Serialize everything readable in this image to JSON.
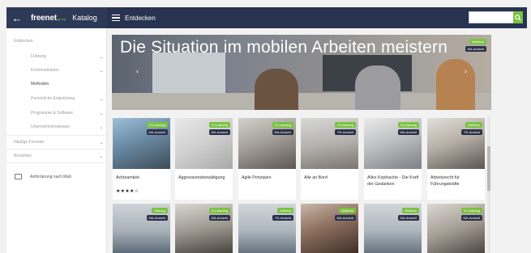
{
  "header": {
    "back_icon": "arrow-left-icon",
    "brand": "freenet",
    "brand_sub": "group",
    "catalog_label": "Katalog",
    "menu_icon": "hamburger-icon",
    "nav_title": "Entdecken",
    "search_placeholder": "",
    "search_icon": "search-icon",
    "accent_color": "#7cc242",
    "bar_color": "#273350"
  },
  "sidebar": {
    "items": [
      {
        "label": "Entdecken",
        "level": "top"
      },
      {
        "label": "Führung",
        "level": "indent"
      },
      {
        "label": "Kommunikation",
        "level": "indent"
      },
      {
        "label": "Methoden",
        "level": "indent",
        "active": true
      },
      {
        "label": "Persönliche Entwicklung",
        "level": "indent"
      },
      {
        "label": "Programme & Software",
        "level": "indent"
      },
      {
        "label": "Unternehmenswissen",
        "level": "indent"
      },
      {
        "label": "Häufige Formate",
        "level": "top"
      },
      {
        "label": "Ansichten",
        "level": "top"
      }
    ],
    "request_label": "Anforderung nach Maß",
    "request_icon": "chat-bubble-icon"
  },
  "hero": {
    "title": "Die Situation im mobilen Arbeiten meistern",
    "badge_type": "Webinar",
    "badge_view": "MA-Ansicht",
    "prev_icon": "chevron-left-icon",
    "next_icon": "chevron-right-icon"
  },
  "cards_row1": [
    {
      "type": "E-Learning",
      "view": "MA-Ansicht",
      "title": "Achtsamkeit",
      "stars": "★★★★☆"
    },
    {
      "type": "E-Learning",
      "view": "MA-Ansicht",
      "title": "Aggressionsbewältigung",
      "stars": ""
    },
    {
      "type": "E-Learning",
      "view": "MA-Ansicht",
      "title": "Agile Prinzipien",
      "stars": ""
    },
    {
      "type": "E-Learning",
      "view": "FK-Ansicht",
      "title": "Alle an Bord",
      "stars": ""
    },
    {
      "type": "E-Learning",
      "view": "MA-Ansicht",
      "title": "Alles Kopfsache - Die Kraft der Gedanken",
      "stars": ""
    },
    {
      "type": "Webinar",
      "view": "FK-Ansicht",
      "title": "Arbeitsrecht für Führungskräfte",
      "stars": ""
    }
  ],
  "cards_row2": [
    {
      "type": "Training",
      "view": "MA-Ansicht"
    },
    {
      "type": "E-Learning",
      "view": "MA-Ansicht"
    },
    {
      "type": "Training",
      "view": "FK-Ansicht"
    },
    {
      "type": "Webinar",
      "view": "MA-Ansicht"
    },
    {
      "type": "Webinar",
      "view": "MA-Ansicht"
    },
    {
      "type": "E-Learning",
      "view": "MA-Ansicht"
    }
  ]
}
